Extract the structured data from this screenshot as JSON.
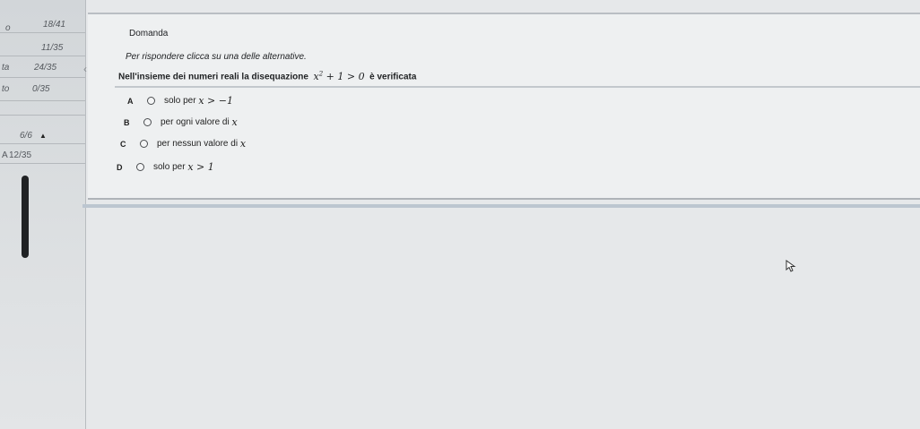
{
  "sidebar": {
    "rows": [
      {
        "label": "o",
        "count": "18/41"
      },
      {
        "label": "",
        "count": "11/35"
      },
      {
        "label": "ta",
        "count": "24/35"
      },
      {
        "label": "to",
        "count": "0/35"
      },
      {
        "label": "",
        "count": "6/6"
      },
      {
        "label": "A",
        "count": "12/35"
      }
    ]
  },
  "question": {
    "title": "Domanda",
    "instruction": "Per rispondere clicca su una delle alternative.",
    "text_prefix": "Nell'insieme dei numeri reali la disequazione",
    "math": {
      "base": "x",
      "exp": "2",
      "rest": "+ 1 > 0"
    },
    "text_suffix": "è verificata",
    "options": [
      {
        "letter": "A",
        "text": "solo per",
        "math": "x > −1"
      },
      {
        "letter": "B",
        "text": "per ogni valore di",
        "math": "x"
      },
      {
        "letter": "C",
        "text": "per nessun valore di",
        "math": "x"
      },
      {
        "letter": "D",
        "text": "solo per",
        "math": "x > 1"
      }
    ]
  },
  "icons": {
    "collapse": "chevron-left-icon",
    "expand_arrow": "triangle-up-icon",
    "cursor": "mouse-cursor-icon"
  }
}
